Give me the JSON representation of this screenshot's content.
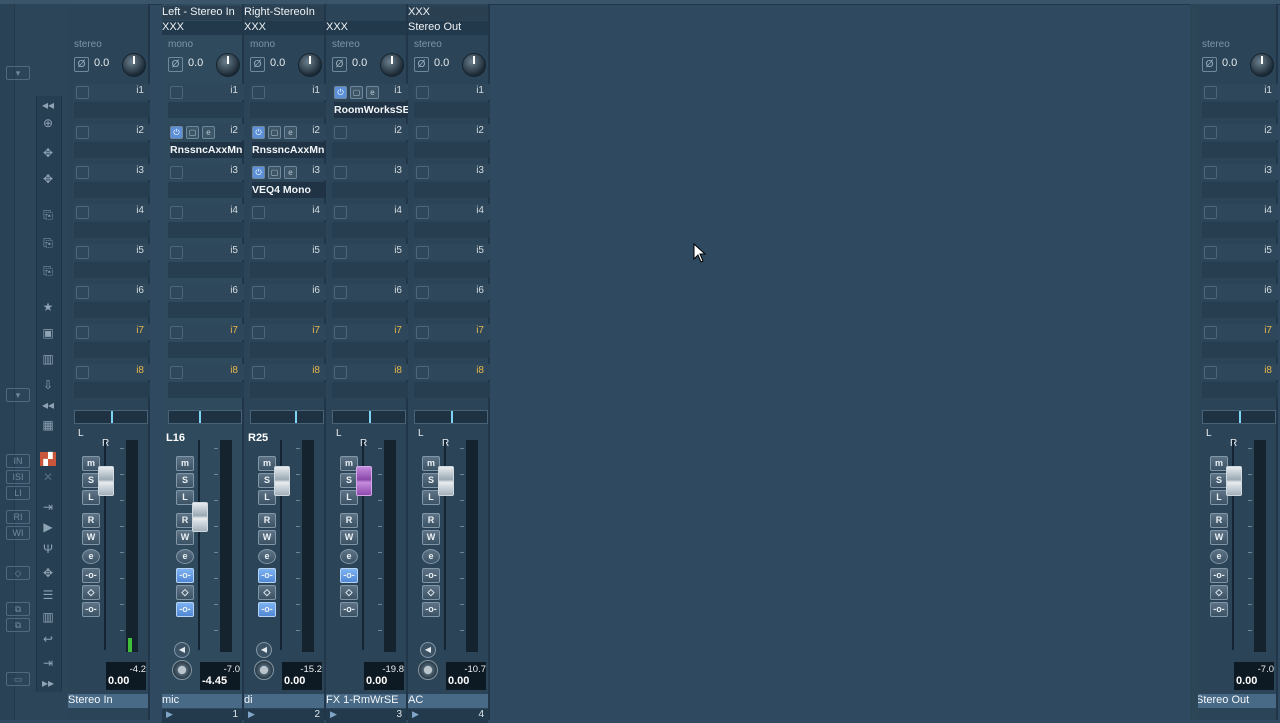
{
  "strips": [
    {
      "id": "stereo-in",
      "name_top": "",
      "output_top": "",
      "config": "stereo",
      "gain": "0.0",
      "inserts": [
        {
          "n": "i1",
          "on": false,
          "name": ""
        },
        {
          "n": "i2",
          "on": false,
          "name": ""
        },
        {
          "n": "i3",
          "on": false,
          "name": ""
        },
        {
          "n": "i4",
          "on": false,
          "name": ""
        },
        {
          "n": "i5",
          "on": false,
          "name": ""
        },
        {
          "n": "i6",
          "on": false,
          "name": ""
        },
        {
          "n": "i7",
          "on": false,
          "name": ""
        },
        {
          "n": "i8",
          "on": false,
          "name": ""
        }
      ],
      "pan_L": "L",
      "pan_R": "R",
      "channel_label": "",
      "buttons": [
        "m",
        "S",
        "L",
        "R",
        "W",
        "e"
      ],
      "fader_level_db": "0.00",
      "peak": "-4.2",
      "volume": "0.00",
      "footer": "Stereo In",
      "index": ""
    },
    {
      "id": "mic",
      "name_top": "Left - Stereo In",
      "output_top": "XXX",
      "config": "mono",
      "gain": "0.0",
      "inserts": [
        {
          "n": "i1",
          "on": false,
          "name": ""
        },
        {
          "n": "i2",
          "on": true,
          "name": "RnssncAxxMn"
        },
        {
          "n": "i3",
          "on": false,
          "name": ""
        },
        {
          "n": "i4",
          "on": false,
          "name": ""
        },
        {
          "n": "i5",
          "on": false,
          "name": ""
        },
        {
          "n": "i6",
          "on": false,
          "name": ""
        },
        {
          "n": "i7",
          "on": false,
          "name": ""
        },
        {
          "n": "i8",
          "on": false,
          "name": ""
        }
      ],
      "pan_L": "",
      "pan_R": "",
      "channel_label": "L16",
      "buttons": [
        "m",
        "S",
        "L",
        "R",
        "W",
        "e"
      ],
      "fader_level_db": "-4.45",
      "peak": "-7.0",
      "volume": "-4.45",
      "footer": "mic",
      "index": "1"
    },
    {
      "id": "di",
      "name_top": "Right-StereoIn",
      "output_top": "XXX",
      "config": "mono",
      "gain": "0.0",
      "inserts": [
        {
          "n": "i1",
          "on": false,
          "name": ""
        },
        {
          "n": "i2",
          "on": true,
          "name": "RnssncAxxMn"
        },
        {
          "n": "i3",
          "on": true,
          "name": "VEQ4 Mono"
        },
        {
          "n": "i4",
          "on": false,
          "name": ""
        },
        {
          "n": "i5",
          "on": false,
          "name": ""
        },
        {
          "n": "i6",
          "on": false,
          "name": ""
        },
        {
          "n": "i7",
          "on": false,
          "name": ""
        },
        {
          "n": "i8",
          "on": false,
          "name": ""
        }
      ],
      "pan_L": "",
      "pan_R": "",
      "channel_label": "R25",
      "buttons": [
        "m",
        "S",
        "L",
        "R",
        "W",
        "e"
      ],
      "fader_level_db": "0.00",
      "peak": "-15.2",
      "volume": "0.00",
      "footer": "di",
      "index": "2"
    },
    {
      "id": "fx1",
      "name_top": "",
      "output_top": "XXX",
      "config": "stereo",
      "gain": "0.0",
      "inserts": [
        {
          "n": "i1",
          "on": true,
          "name": "RoomWorksSE"
        },
        {
          "n": "i2",
          "on": false,
          "name": ""
        },
        {
          "n": "i3",
          "on": false,
          "name": ""
        },
        {
          "n": "i4",
          "on": false,
          "name": ""
        },
        {
          "n": "i5",
          "on": false,
          "name": ""
        },
        {
          "n": "i6",
          "on": false,
          "name": ""
        },
        {
          "n": "i7",
          "on": false,
          "name": ""
        },
        {
          "n": "i8",
          "on": false,
          "name": ""
        }
      ],
      "pan_L": "L",
      "pan_R": "R",
      "channel_label": "",
      "buttons": [
        "m",
        "S",
        "L",
        "R",
        "W",
        "e"
      ],
      "fader_level_db": "0.00",
      "peak": "-19.8",
      "volume": "0.00",
      "footer": "FX 1-RmWrSE",
      "index": "3"
    },
    {
      "id": "ac",
      "name_top": "XXX",
      "output_top": "Stereo Out",
      "config": "stereo",
      "gain": "0.0",
      "inserts": [
        {
          "n": "i1",
          "on": false,
          "name": ""
        },
        {
          "n": "i2",
          "on": false,
          "name": ""
        },
        {
          "n": "i3",
          "on": false,
          "name": ""
        },
        {
          "n": "i4",
          "on": false,
          "name": ""
        },
        {
          "n": "i5",
          "on": false,
          "name": ""
        },
        {
          "n": "i6",
          "on": false,
          "name": ""
        },
        {
          "n": "i7",
          "on": false,
          "name": ""
        },
        {
          "n": "i8",
          "on": false,
          "name": ""
        }
      ],
      "pan_L": "L",
      "pan_R": "R",
      "channel_label": "",
      "buttons": [
        "m",
        "S",
        "L",
        "R",
        "W",
        "e"
      ],
      "fader_level_db": "0.00",
      "peak": "-10.7",
      "volume": "0.00",
      "footer": "AC",
      "index": "4"
    },
    {
      "id": "stereo-out",
      "name_top": "",
      "output_top": "",
      "config": "stereo",
      "gain": "0.0",
      "inserts": [
        {
          "n": "i1",
          "on": false,
          "name": ""
        },
        {
          "n": "i2",
          "on": false,
          "name": ""
        },
        {
          "n": "i3",
          "on": false,
          "name": ""
        },
        {
          "n": "i4",
          "on": false,
          "name": ""
        },
        {
          "n": "i5",
          "on": false,
          "name": ""
        },
        {
          "n": "i6",
          "on": false,
          "name": ""
        },
        {
          "n": "i7",
          "on": false,
          "name": ""
        },
        {
          "n": "i8",
          "on": false,
          "name": ""
        }
      ],
      "pan_L": "L",
      "pan_R": "R",
      "channel_label": "",
      "buttons": [
        "m",
        "S",
        "L",
        "R",
        "W",
        "e"
      ],
      "fader_level_db": "0.00",
      "peak": "-7.0",
      "volume": "0.00",
      "footer": "Stereo Out",
      "index": ""
    }
  ],
  "colors": {
    "background": "#2f4a60",
    "strip": "#2b4457",
    "insert_active": "#5b8fd8",
    "footer": "#486a86",
    "fx_fader": "#8a47a9",
    "meter_green": "#3fbf3a",
    "tool_accent": "#c9553a"
  },
  "tool_icons": [
    "move-icon",
    "split-icon",
    "route-icon",
    "favorites-star-icon",
    "panel-icon",
    "meter-icon",
    "freeze-icon",
    "mixer-icon",
    "record-icon",
    "play-icon",
    "monitor-icon",
    "link-icon",
    "wrench-icon"
  ]
}
